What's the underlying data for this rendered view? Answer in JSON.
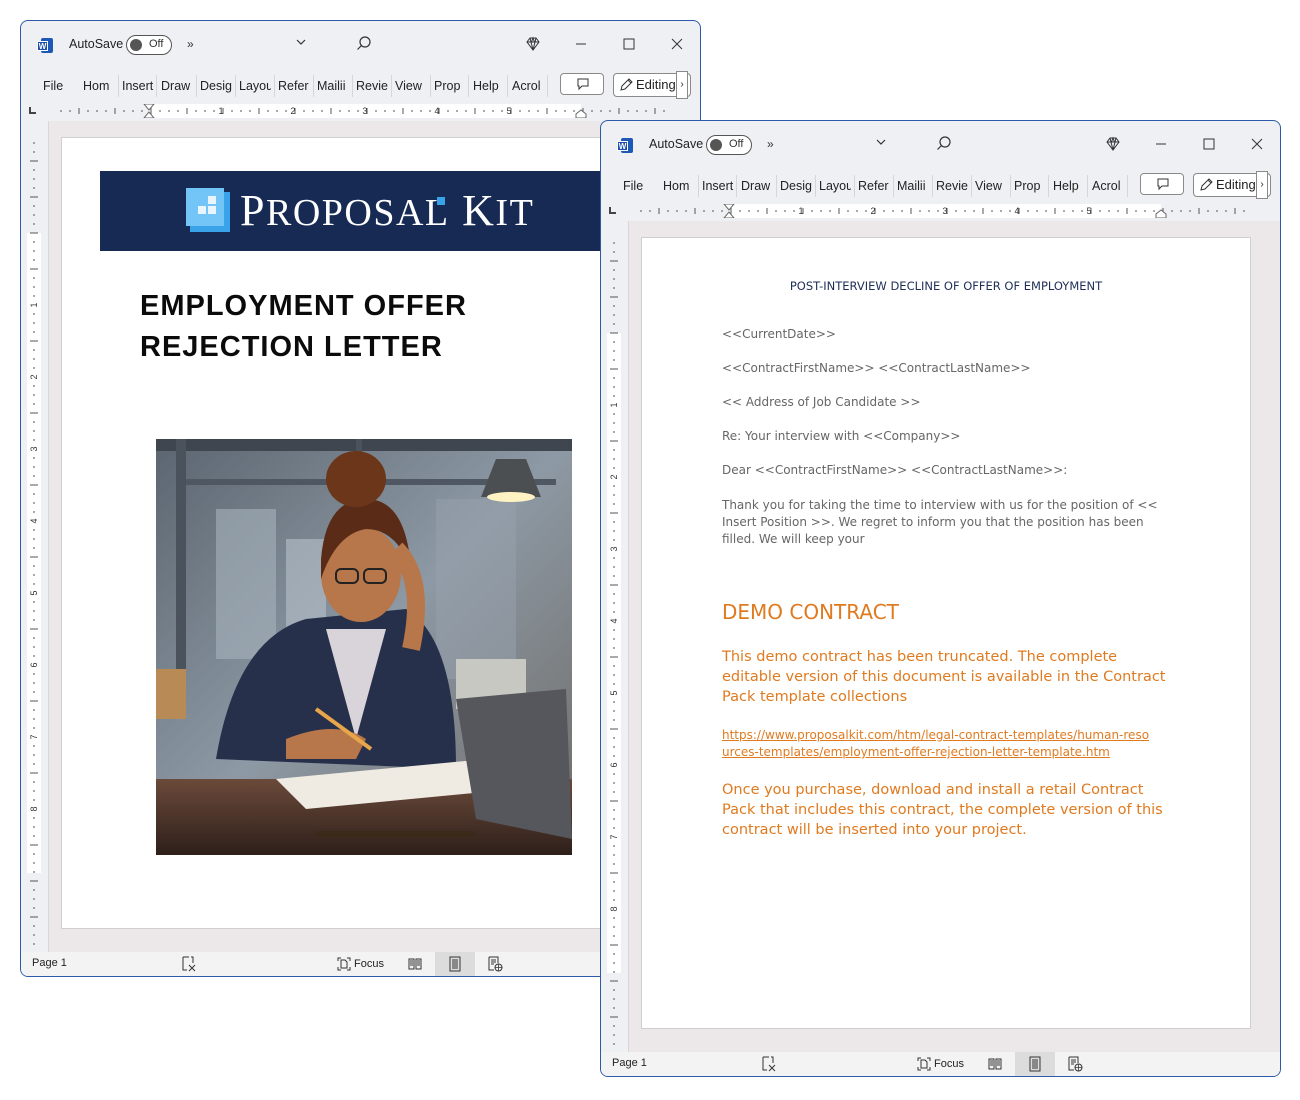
{
  "colors": {
    "window_border": "#2d5aa8",
    "banner_navy": "#172a54",
    "logo_blue": "#3aa2e8",
    "demo_orange": "#e07a1f",
    "heading_navy": "#1f2e56"
  },
  "windows": [
    {
      "titlebar": {
        "autosave_label": "AutoSave",
        "autosave_state": "Off",
        "more_label": "»",
        "icons": [
          "word-app-icon",
          "chevron-down-icon",
          "search-icon",
          "diamond-icon",
          "minimize-icon",
          "maximize-icon",
          "close-icon"
        ]
      },
      "ribbon": {
        "tabs": [
          "File",
          "Hom",
          "Insert",
          "Draw",
          "Desig",
          "Layou",
          "Refer",
          "Mailii",
          "Revie",
          "View",
          "Prop",
          "Help",
          "Acrol"
        ],
        "editing_label": "Editing"
      },
      "ruler": {
        "marks": [
          "1",
          "2",
          "3",
          "4",
          "5"
        ],
        "vmarks": [
          "1",
          "2",
          "3",
          "4",
          "5",
          "6",
          "7",
          "8"
        ]
      },
      "document": {
        "brand_prefix": "P",
        "brand_rest": "ROPOSAL",
        "brand_k": "K",
        "brand_it": "IT",
        "title_line1": "EMPLOYMENT OFFER",
        "title_line2": "REJECTION LETTER",
        "image_alt": "Illustration of a stressed woman in glasses writing at a desk with a laptop"
      },
      "status": {
        "page": "Page 1",
        "focus_label": "Focus"
      }
    },
    {
      "titlebar": {
        "autosave_label": "AutoSave",
        "autosave_state": "Off",
        "more_label": "»"
      },
      "ribbon": {
        "tabs": [
          "File",
          "Hom",
          "Insert",
          "Draw",
          "Desig",
          "Layou",
          "Refer",
          "Mailii",
          "Revie",
          "View",
          "Prop",
          "Help",
          "Acrol"
        ],
        "editing_label": "Editing"
      },
      "ruler": {
        "marks": [
          "1",
          "2",
          "3",
          "4",
          "5"
        ],
        "vmarks": [
          "1",
          "2",
          "3",
          "4",
          "5",
          "6",
          "7",
          "8"
        ]
      },
      "document": {
        "heading": "POST-INTERVIEW DECLINE OF OFFER OF EMPLOYMENT",
        "lines": [
          "<<CurrentDate>>",
          "<<ContractFirstName>> <<ContractLastName>>",
          "<< Address of Job Candidate >>",
          "Re: Your interview with <<Company>>",
          "Dear <<ContractFirstName>> <<ContractLastName>>:"
        ],
        "body": "Thank you for taking the time to interview with us for the position of << Insert Position >>. We regret to inform you that the position has been filled. We will keep your",
        "demo_heading": "DEMO CONTRACT",
        "demo_para1": "This demo contract has been truncated. The complete editable version of this document is available in the Contract Pack template collections",
        "demo_link": "https://www.proposalkit.com/htm/legal-contract-templates/human-resources-templates/employment-offer-rejection-letter-template.htm",
        "demo_para2": "Once you purchase, download and install a retail Contract Pack that includes this contract, the complete version of this contract will be inserted into your project."
      },
      "status": {
        "page": "Page 1",
        "focus_label": "Focus"
      }
    }
  ]
}
